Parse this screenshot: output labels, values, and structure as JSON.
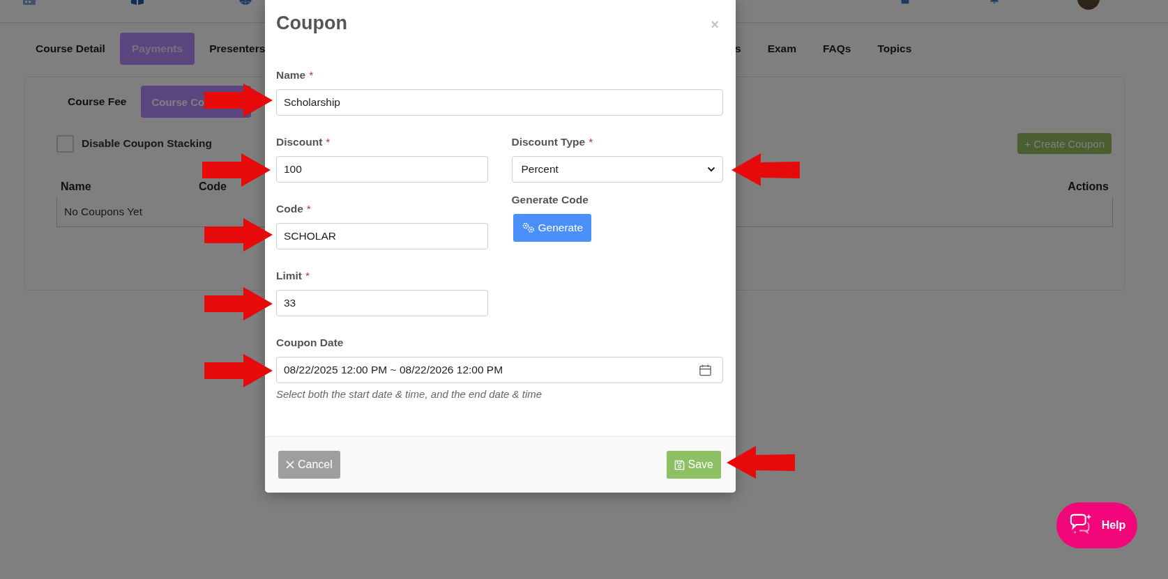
{
  "course_tabs": [
    {
      "label": "Course Detail",
      "selected": false
    },
    {
      "label": "Payments",
      "selected": true
    },
    {
      "label": "Presenters",
      "selected": false
    },
    {
      "label": "s",
      "selected": false
    },
    {
      "label": "Exam",
      "selected": false
    },
    {
      "label": "FAQs",
      "selected": false
    },
    {
      "label": "Topics",
      "selected": false
    }
  ],
  "payment_tabs": [
    {
      "label": "Course Fee",
      "selected": false
    },
    {
      "label": "Course Co",
      "selected": true
    }
  ],
  "coupon_stacking": {
    "label": "Disable Coupon Stacking",
    "checked": false
  },
  "create_button": "+ Create Coupon",
  "coupons_table": {
    "columns": [
      "Name",
      "Code",
      "Actions"
    ],
    "empty_message": "No Coupons Yet"
  },
  "coupon_modal": {
    "title": "Coupon",
    "close": "×",
    "rows": [
      [
        {
          "kind": "text",
          "label": "Name",
          "required_mark": "*",
          "value": "Scholarship"
        }
      ],
      [
        {
          "kind": "text",
          "label": "Discount",
          "required_mark": "*",
          "value": "100"
        },
        {
          "kind": "select",
          "label": "Discount Type",
          "required_mark": "*",
          "value": "Percent"
        }
      ],
      [
        {
          "kind": "text",
          "label": "Code",
          "required_mark": "*",
          "value": "SCHOLAR"
        },
        {
          "kind": "action",
          "label": "Generate Code",
          "button": "Generate"
        }
      ],
      [
        {
          "kind": "text",
          "label": "Limit",
          "required_mark": "*",
          "value": "33"
        }
      ],
      [
        {
          "kind": "daterange",
          "label": "Coupon Date",
          "value": "08/22/2025 12:00 PM ~ 08/22/2026 12:00 PM",
          "help": "Select both the start date & time, and the end date & time"
        }
      ]
    ],
    "buttons": [
      {
        "kind": "cancel",
        "label": "Cancel"
      },
      {
        "kind": "save",
        "label": "Save"
      }
    ]
  },
  "help_button": {
    "label": "Help"
  }
}
